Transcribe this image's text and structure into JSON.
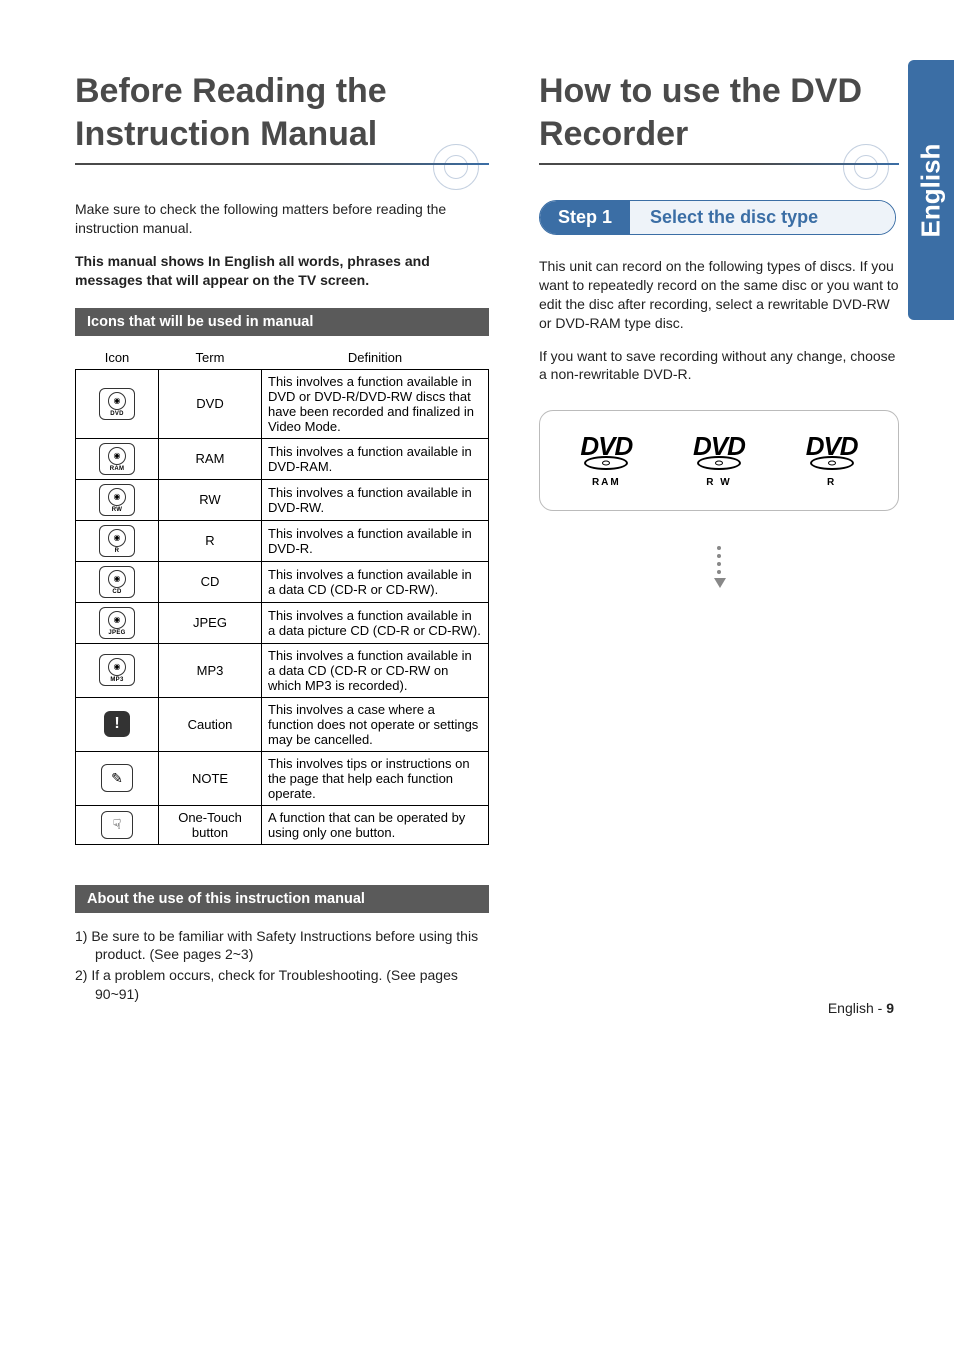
{
  "side_tab": "English",
  "left": {
    "title": "Before Reading the Instruction Manual",
    "intro": "Make sure to check the following matters before reading the instruction manual.",
    "bold_note": "This manual shows In English all words, phrases and messages that will appear on the TV screen.",
    "section_icons_heading": "Icons that will be used in manual",
    "table": {
      "headers": {
        "icon": "Icon",
        "term": "Term",
        "definition": "Definition"
      },
      "rows": [
        {
          "icon_label": "DVD",
          "term": "DVD",
          "definition": "This involves a function available in DVD or DVD-R/DVD-RW discs that have been recorded and finalized in Video Mode."
        },
        {
          "icon_label": "RAM",
          "term": "RAM",
          "definition": "This involves a function available in DVD-RAM."
        },
        {
          "icon_label": "RW",
          "term": "RW",
          "definition": "This involves a function available in DVD-RW."
        },
        {
          "icon_label": "R",
          "term": "R",
          "definition": "This involves a function available in DVD-R."
        },
        {
          "icon_label": "CD",
          "term": "CD",
          "definition": "This involves a function available in a data CD (CD-R or CD-RW)."
        },
        {
          "icon_label": "JPEG",
          "term": "JPEG",
          "definition": "This involves a function available in a data picture CD (CD-R or CD-RW)."
        },
        {
          "icon_label": "MP3",
          "term": "MP3",
          "definition": "This involves a function available in a data CD (CD-R or CD-RW on which MP3 is recorded)."
        },
        {
          "icon_label": "!",
          "term": "Caution",
          "definition": "This involves a case where a function does not operate or settings may be cancelled."
        },
        {
          "icon_label": "✎",
          "term": "NOTE",
          "definition": "This involves tips or instructions on the page that help each function operate."
        },
        {
          "icon_label": "☟",
          "term": "One-Touch button",
          "definition": "A function that can be operated by using only one button."
        }
      ]
    },
    "section_about_heading": "About the use of this instruction manual",
    "notes": [
      "1) Be sure to be familiar with Safety Instructions before using this product. (See pages 2~3)",
      "2) If a problem occurs, check for Troubleshooting. (See pages 90~91)"
    ]
  },
  "right": {
    "title": "How to use the DVD Recorder",
    "step": {
      "num": "Step 1",
      "title": "Select the disc type"
    },
    "para1": "This unit can record on the following types of discs. If you want to repeatedly record on the same disc or you want to edit the disc after recording, select a rewritable DVD-RW or DVD-RAM type disc.",
    "para2": "If you want to save recording without any change, choose a non-rewritable DVD-R.",
    "logos": [
      {
        "main": "DVD",
        "sub": "RAM"
      },
      {
        "main": "DVD",
        "sub": "R W"
      },
      {
        "main": "DVD",
        "sub": "R"
      }
    ]
  },
  "footer": {
    "lang": "English",
    "sep": " - ",
    "page": "9"
  }
}
